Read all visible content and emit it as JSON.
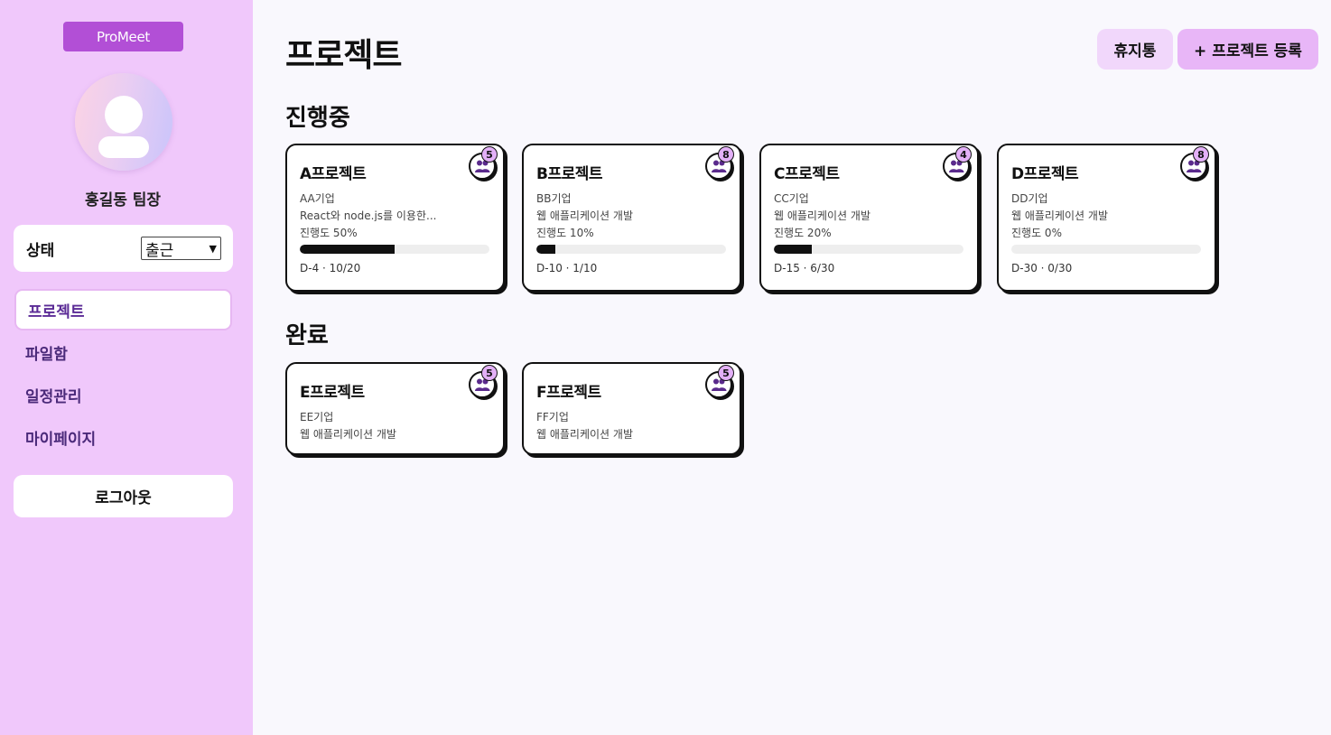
{
  "sidebar": {
    "brand": "ProMeet",
    "user_name": "홍길동 팀장",
    "status_label": "상태",
    "status_value": "출근",
    "nav": [
      "프로젝트",
      "파일함",
      "일정관리",
      "마이페이지"
    ],
    "logout": "로그아웃"
  },
  "main": {
    "title": "프로젝트",
    "trash_button": "휴지통",
    "add_button": "+ 프로젝트 등록",
    "sections": {
      "ongoing": "진행중",
      "done": "완료"
    },
    "ongoing_projects": [
      {
        "name": "A프로젝트",
        "company": "AA기업",
        "desc": "React와 node.js를 이용한...",
        "progress_label": "진행도 50%",
        "progress": 50,
        "due": "D-4 · 10/20",
        "members": "5"
      },
      {
        "name": "B프로젝트",
        "company": "BB기업",
        "desc": "웹 애플리케이션 개발",
        "progress_label": "진행도 10%",
        "progress": 10,
        "due": "D-10 · 1/10",
        "members": "8"
      },
      {
        "name": "C프로젝트",
        "company": "CC기업",
        "desc": "웹 애플리케이션 개발",
        "progress_label": "진행도 20%",
        "progress": 20,
        "due": "D-15 · 6/30",
        "members": "4"
      },
      {
        "name": "D프로젝트",
        "company": "DD기업",
        "desc": "웹 애플리케이션 개발",
        "progress_label": "진행도 0%",
        "progress": 0,
        "due": "D-30 · 0/30",
        "members": "8"
      }
    ],
    "done_projects": [
      {
        "name": "E프로젝트",
        "company": "EE기업",
        "desc": "웹 애플리케이션 개발",
        "members": "5"
      },
      {
        "name": "F프로젝트",
        "company": "FF기업",
        "desc": "웹 애플리케이션 개발",
        "members": "5"
      }
    ]
  },
  "icons": {
    "member": "people-icon",
    "avatar": "user-avatar-icon"
  },
  "colors": {
    "sidebar_bg": "#f0c8fb",
    "brand_bg": "#b24fd6",
    "badge_bg": "#e3b0f7",
    "main_bg": "#f9f8fd"
  }
}
